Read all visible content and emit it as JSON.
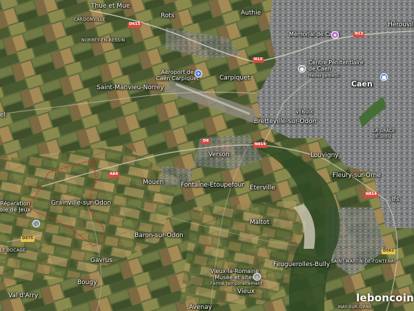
{
  "map": {
    "view": "satellite",
    "brand": "leboncoin",
    "search_area_border_color": "#c0392b",
    "places": {
      "thue_et_mue": "Thue et Mue",
      "rots": "Rots",
      "authie": "Authie",
      "herouville": "Hérouville",
      "cardonville": "CARDONVILLE",
      "norrey": "NORREY-EN-BESSIN",
      "memorial": "Mémorial de Caen",
      "airport": "Aéroport de\nCaen Carpiquet",
      "carpiquet": "Carpiquet",
      "prison": "Centre Pénitentiaire\nde Caen",
      "prison_sub": "Hébergement",
      "caen": "Caen",
      "saint_manvieu": "Saint-Manvieu-Norrey",
      "venoix": "VENOIX",
      "bretteville": "Bretteville-sur-Odon",
      "la_grace": "LA GRÂCE\nDE DIEU",
      "verson": "Verson",
      "louvigny": "Louvigny",
      "mouen": "Mouen",
      "fontaine": "Fontaine-Étoupefour",
      "eterville": "Éterville",
      "fleury": "Fleury-sur-Orne",
      "ifs": "Ifs",
      "grainville": "Grainville-sur-Odon",
      "reparation": "Réparation\nole de Jeux",
      "maltot": "Maltot",
      "le_bocage": "LE BOCAGE",
      "baron": "Baron-sur-Odon",
      "gavrus": "Gavrus",
      "feuguerolles": "Feuguerolles-Bully",
      "saint_martin": "SAINT-MARTIN-DE-FONTENAY",
      "vieux_romaine": "Vieux-la-Romaine\nMusée et sites",
      "vieux_romaine_sub": "Fermé temporairement",
      "vieux": "Vieux",
      "bougy": "Bougy",
      "val_darry": "Val d'Arry",
      "avenay": "Avenay",
      "may_sur_orne": "MAY-SUR-ORNE",
      "el": "el"
    },
    "roads": {
      "d613": "D613",
      "n13_a": "N13",
      "n13_b": "N13",
      "d8": "D8",
      "a84": "A84",
      "n814": "N814",
      "n814_b": "N814",
      "d675": "D675",
      "d562": "D562"
    },
    "icons": {
      "airport": "airplane-icon",
      "memorial": "museum-icon",
      "prison": "pin-icon",
      "caen": "city-hall-icon",
      "repair": "wrench-pin-icon",
      "vieux": "museum-pin-icon"
    }
  }
}
